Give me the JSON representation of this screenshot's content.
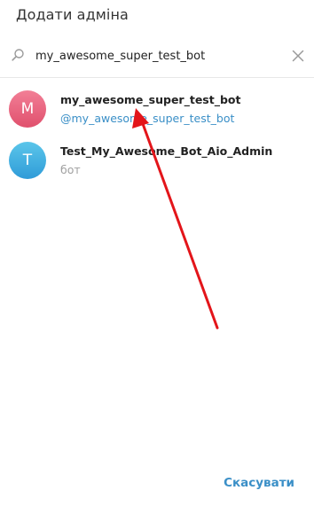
{
  "dialog": {
    "title": "Додати адміна"
  },
  "search": {
    "value": "my_awesome_super_test_bot",
    "icon": "search-icon",
    "clear_icon": "close-icon"
  },
  "results": [
    {
      "avatar_letter": "M",
      "name": "my_awesome_super_test_bot",
      "subtitle": "@my_awesome_super_test_bot",
      "avatar_color": "#e9607c"
    },
    {
      "avatar_letter": "T",
      "name": "Test_My_Awesome_Bot_Aio_Admin",
      "subtitle": "бот",
      "avatar_color": "#3fa9e0"
    }
  ],
  "footer": {
    "cancel_label": "Скасувати"
  },
  "colors": {
    "accent": "#3a8fc7",
    "annotation_arrow": "#e3151a"
  }
}
